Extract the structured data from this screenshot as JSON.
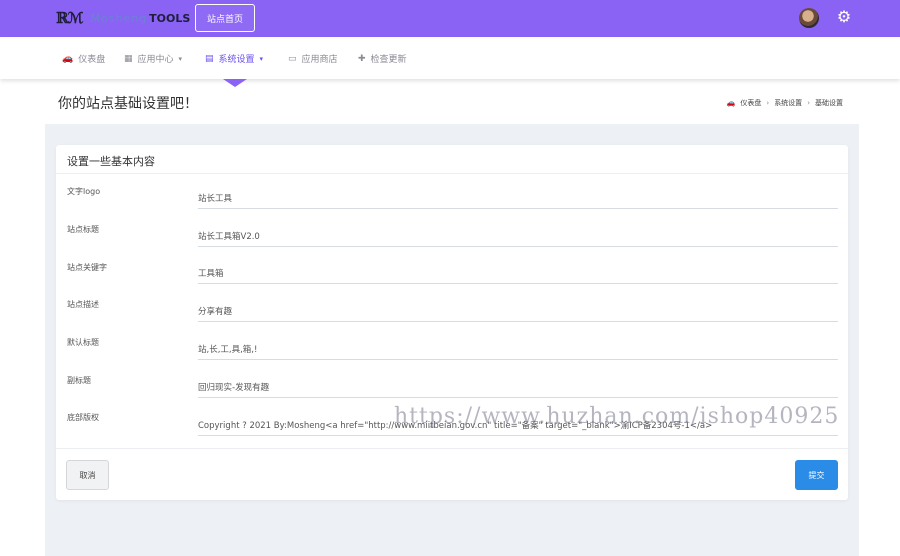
{
  "topbar": {
    "logo_mark": "ℝℳ",
    "logo_text": "Mosheng",
    "logo_tools": "TOOLS",
    "home_button": "站点首页",
    "bg_color": "#8a63f5"
  },
  "nav": {
    "items": [
      {
        "label": "仪表盘",
        "icon": "dashboard-icon",
        "glyph": "🚗"
      },
      {
        "label": "应用中心",
        "icon": "grid-icon",
        "glyph": "▦",
        "caret": "▾"
      },
      {
        "label": "系统设置",
        "icon": "table-icon",
        "glyph": "▤",
        "caret": "▾"
      },
      {
        "label": "应用商店",
        "icon": "laptop-icon",
        "glyph": "▭"
      },
      {
        "label": "检查更新",
        "icon": "puzzle-icon",
        "glyph": "✚"
      }
    ]
  },
  "page": {
    "title": "你的站点基础设置吧！"
  },
  "breadcrumb": {
    "items": [
      "仪表盘",
      "系统设置",
      "基础设置"
    ]
  },
  "card": {
    "title": "设置一些基本内容",
    "fields": [
      {
        "label": "文字logo",
        "value": "站长工具"
      },
      {
        "label": "站点标题",
        "value": "站长工具箱V2.0"
      },
      {
        "label": "站点关键字",
        "value": "工具箱"
      },
      {
        "label": "站点描述",
        "value": "分享有趣"
      },
      {
        "label": "默认标题",
        "value": "站,长,工,具,箱,!"
      },
      {
        "label": "副标题",
        "value": "回归现实-发现有趣"
      },
      {
        "label": "底部版权",
        "value": "Copyright ? 2021 By:Mosheng<a href=\"http://www.miitbeian.gov.cn\" title=\"备案\" target=\"_blank\">渝ICP备2304号-1</a>"
      }
    ],
    "cancel": "取消",
    "submit": "提交"
  },
  "watermark": "https://www.huzhan.com/ishop40925",
  "colors": {
    "accent": "#8a63f5",
    "primary_button": "#2b8ce8",
    "active_nav": "#6b4ff0"
  }
}
